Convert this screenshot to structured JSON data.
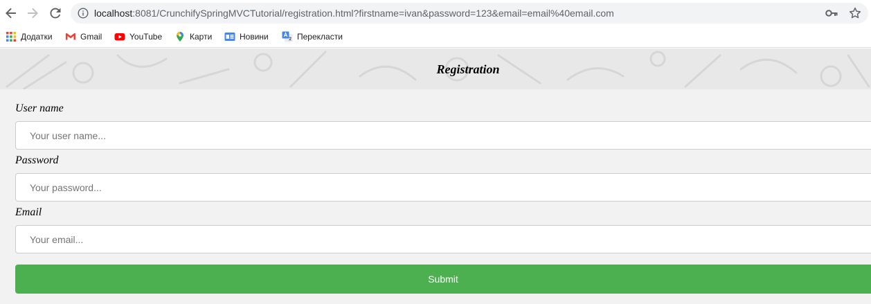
{
  "browser": {
    "url_host": "localhost",
    "url_rest": ":8081/CrunchifySpringMVCTutorial/registration.html?firstname=ivan&password=123&email=email%40email.com",
    "bookmarks": [
      {
        "label": "Додатки",
        "icon": "apps-grid-icon"
      },
      {
        "label": "Gmail",
        "icon": "gmail-icon"
      },
      {
        "label": "YouTube",
        "icon": "youtube-icon"
      },
      {
        "label": "Карти",
        "icon": "maps-pin-icon"
      },
      {
        "label": "Новини",
        "icon": "news-icon"
      },
      {
        "label": "Перекласти",
        "icon": "translate-icon"
      }
    ],
    "icons": [
      "back-arrow-icon",
      "forward-arrow-icon",
      "reload-icon",
      "info-icon",
      "key-icon",
      "star-icon"
    ]
  },
  "page": {
    "title": "Registration",
    "fields": [
      {
        "label": "User name",
        "placeholder": "Your user name..."
      },
      {
        "label": "Password",
        "placeholder": "Your password..."
      },
      {
        "label": "Email",
        "placeholder": "Your email..."
      }
    ],
    "submit_label": "Submit"
  },
  "colors": {
    "submit_bg": "#4caf50",
    "page_bg": "#f2f2f2",
    "banner_bg": "#e8e8e8"
  }
}
